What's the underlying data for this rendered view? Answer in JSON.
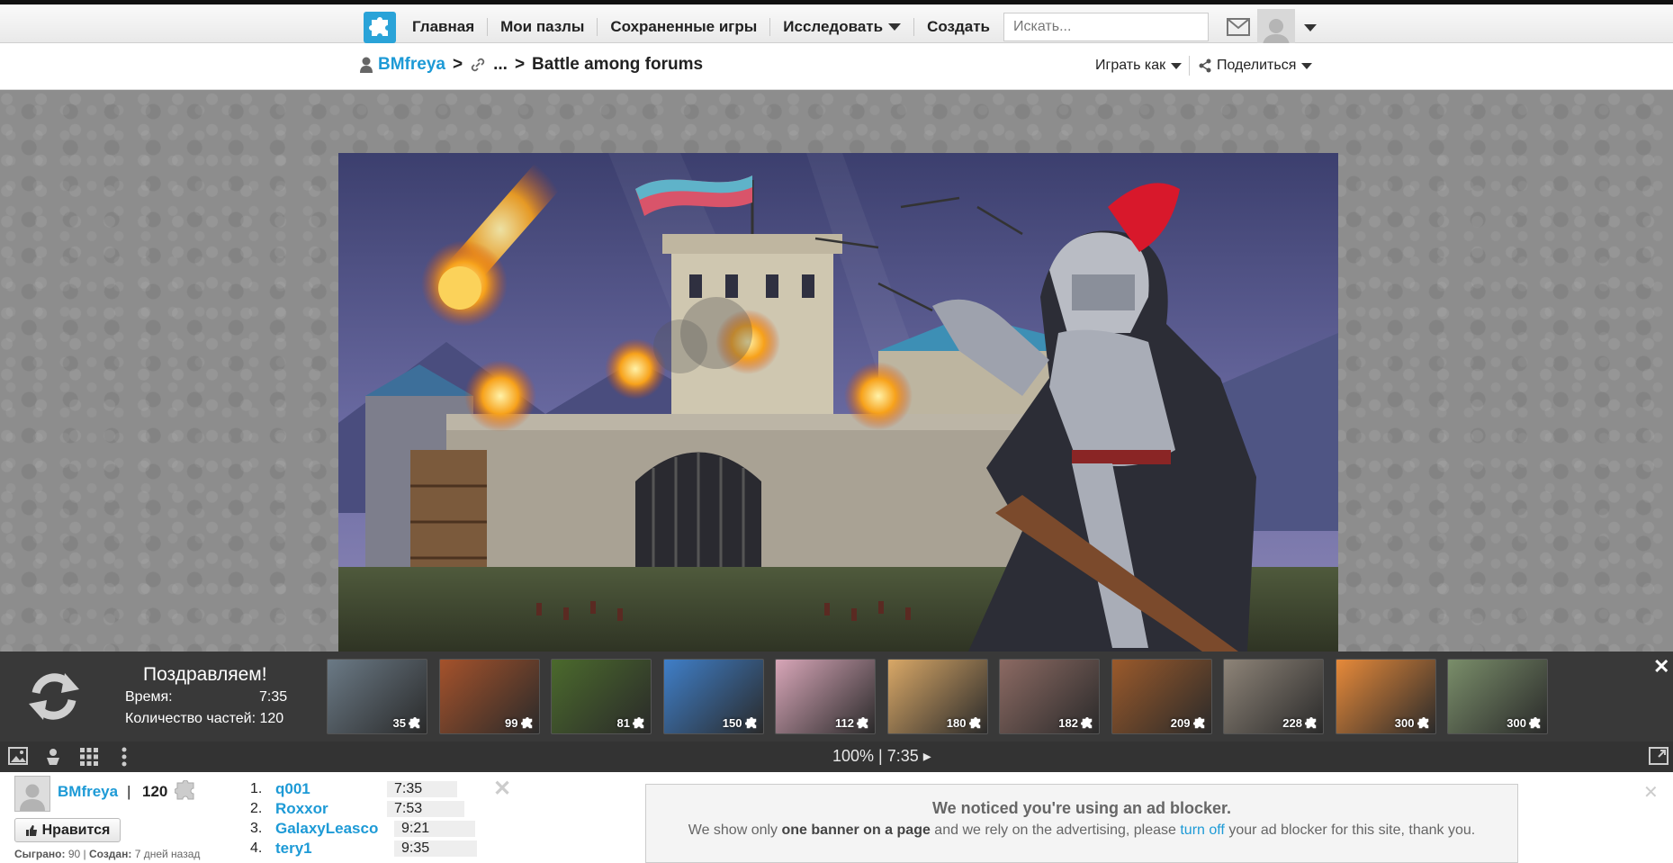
{
  "nav": {
    "home": "Главная",
    "my_puzzles": "Мои пазлы",
    "saved_games": "Сохраненные игры",
    "explore": "Исследовать",
    "create": "Создать",
    "search_placeholder": "Искать..."
  },
  "breadcrumb": {
    "user": "BMfreya",
    "separator": ">",
    "ellipsis": "...",
    "title": "Battle among forums",
    "play_as": "Играть как",
    "share": "Поделиться"
  },
  "congrats": {
    "title": "Поздравляем!",
    "time_label": "Время:",
    "time_value": "7:35",
    "pieces_label": "Количество частей: 120",
    "close": "✕",
    "thumbnails": [
      {
        "count": "35",
        "color": "#6b7a86"
      },
      {
        "count": "99",
        "color": "#a5522b"
      },
      {
        "count": "81",
        "color": "#4b6a2c"
      },
      {
        "count": "150",
        "color": "#3f7fc9"
      },
      {
        "count": "112",
        "color": "#d8a6b8"
      },
      {
        "count": "180",
        "color": "#d9a867"
      },
      {
        "count": "182",
        "color": "#8c6a63"
      },
      {
        "count": "209",
        "color": "#9b5a2b"
      },
      {
        "count": "228",
        "color": "#8e8478"
      },
      {
        "count": "300",
        "color": "#e78a3a"
      },
      {
        "count": "300",
        "color": "#7a8e6a"
      }
    ]
  },
  "toolbar": {
    "status": "100% | 7:35 ▸"
  },
  "bottom": {
    "user": "BMfreya",
    "pipe": "|",
    "pieces": "120",
    "like": "Нравится",
    "played_label": "Сыграно:",
    "played_value": "90",
    "created_label": "Создан:",
    "created_value": "7 дней назад",
    "leaderboard": [
      {
        "rank": "1.",
        "name": "q001",
        "time": "7:35"
      },
      {
        "rank": "2.",
        "name": "Roxxor",
        "time": "7:53"
      },
      {
        "rank": "3.",
        "name": "GalaxyLeasco",
        "time": "9:21"
      },
      {
        "rank": "4.",
        "name": "tery1",
        "time": "9:35"
      }
    ]
  },
  "adblock": {
    "title": "We noticed you're using an ad blocker.",
    "text_1": "We show only ",
    "text_bold": "one banner on a page",
    "text_2": " and we rely on the advertising, please ",
    "link": "turn off",
    "text_3": " your ad blocker for this site, thank you."
  },
  "colors": {
    "brand": "#2aa3d8",
    "link": "#1d9ad6"
  }
}
